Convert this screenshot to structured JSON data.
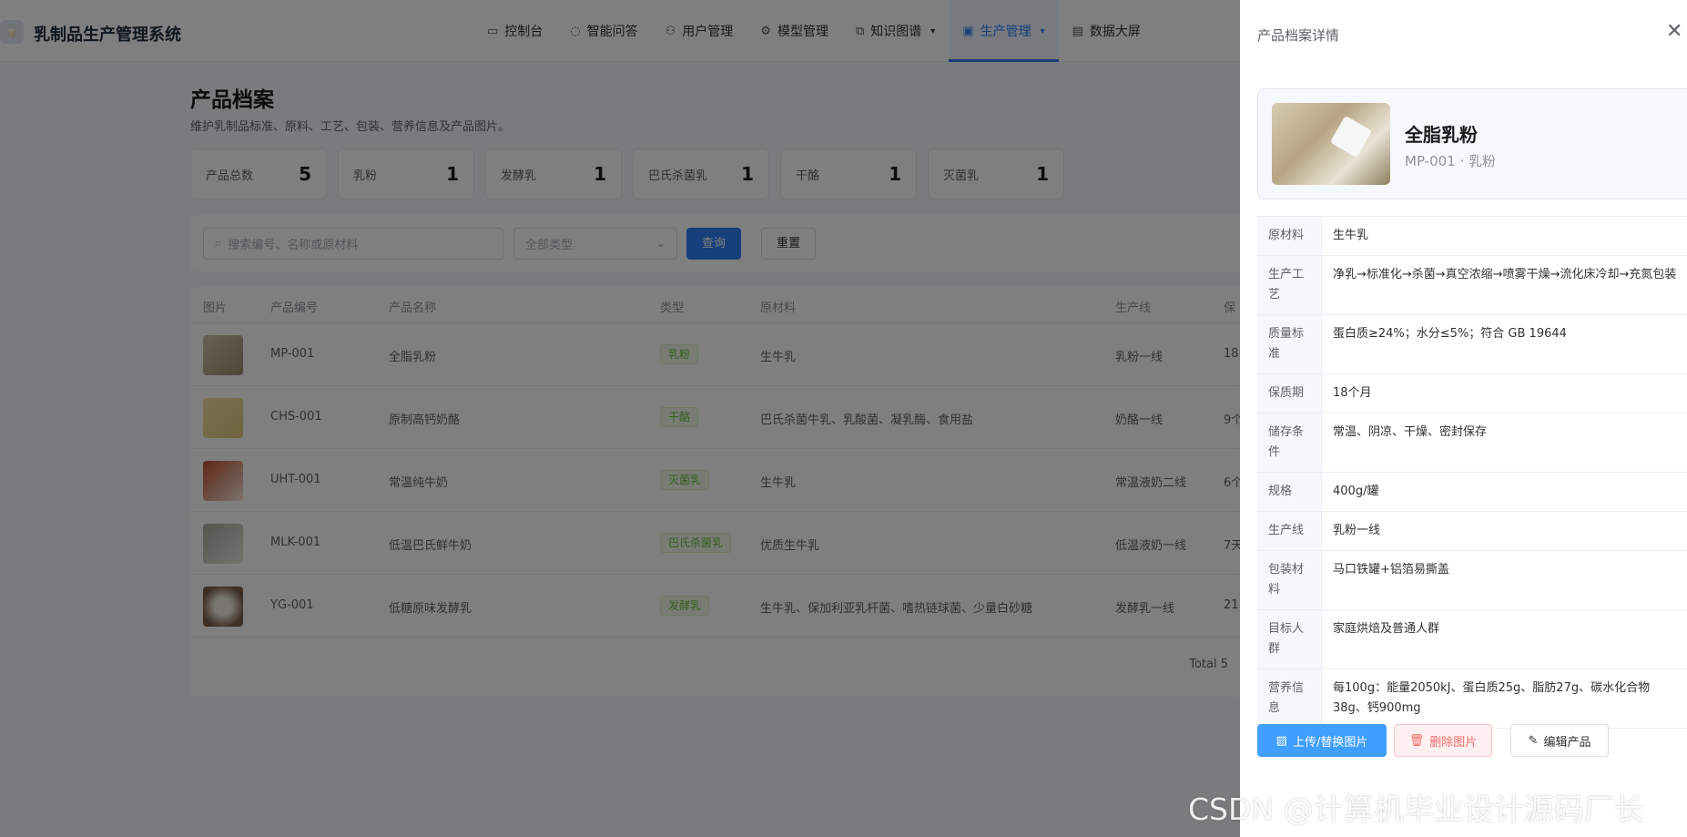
{
  "header": {
    "app_title": "乳制品生产管理系统",
    "logo_icon": "milk-cup-icon",
    "nav": [
      {
        "label": "控制台",
        "icon": "monitor-icon"
      },
      {
        "label": "智能问答",
        "icon": "chat-icon"
      },
      {
        "label": "用户管理",
        "icon": "user-icon"
      },
      {
        "label": "模型管理",
        "icon": "gear-icon"
      },
      {
        "label": "知识图谱",
        "icon": "graph-icon"
      },
      {
        "label": "生产管理",
        "icon": "factory-icon"
      },
      {
        "label": "数据大屏",
        "icon": "dashboard-icon"
      }
    ]
  },
  "page": {
    "title": "产品档案",
    "subtitle": "维护乳制品标准、原料、工艺、包装、营养信息及产品图片。"
  },
  "stats": [
    {
      "label": "产品总数",
      "value": "5"
    },
    {
      "label": "乳粉",
      "value": "1"
    },
    {
      "label": "发酵乳",
      "value": "1"
    },
    {
      "label": "巴氏杀菌乳",
      "value": "1"
    },
    {
      "label": "干酪",
      "value": "1"
    },
    {
      "label": "灭菌乳",
      "value": "1"
    }
  ],
  "filter": {
    "search_placeholder": "搜索编号、名称或原材料",
    "type_placeholder": "全部类型",
    "query_label": "查询",
    "reset_label": "重置"
  },
  "table": {
    "headers": [
      "图片",
      "产品编号",
      "产品名称",
      "类型",
      "原材料",
      "生产线",
      "保"
    ],
    "rows": [
      {
        "code": "MP-001",
        "name": "全脂乳粉",
        "type": "乳粉",
        "material": "生牛乳",
        "line": "乳粉一线",
        "shelf": "18"
      },
      {
        "code": "CHS-001",
        "name": "原制高钙奶酪",
        "type": "干酪",
        "material": "巴氏杀菌牛乳、乳酸菌、凝乳酶、食用盐",
        "line": "奶酪一线",
        "shelf": "9个"
      },
      {
        "code": "UHT-001",
        "name": "常温纯牛奶",
        "type": "灭菌乳",
        "material": "生牛乳",
        "line": "常温液奶二线",
        "shelf": "6个"
      },
      {
        "code": "MLK-001",
        "name": "低温巴氏鲜牛奶",
        "type": "巴氏杀菌乳",
        "material": "优质生牛乳",
        "line": "低温液奶一线",
        "shelf": "7天"
      },
      {
        "code": "YG-001",
        "name": "低糖原味发酵乳",
        "type": "发酵乳",
        "material": "生牛乳、保加利亚乳杆菌、嗜热链球菌、少量白砂糖",
        "line": "发酵乳一线",
        "shelf": "21"
      }
    ],
    "total": "Total 5"
  },
  "drawer": {
    "title": "产品档案详情",
    "product_name": "全脂乳粉",
    "product_meta": "MP-001 · 乳粉",
    "details": [
      {
        "label": "原材料",
        "value": "生牛乳"
      },
      {
        "label": "生产工艺",
        "value": "净乳→标准化→杀菌→真空浓缩→喷雾干燥→流化床冷却→充氮包装"
      },
      {
        "label": "质量标准",
        "value": "蛋白质≥24%；水分≤5%；符合 GB 19644"
      },
      {
        "label": "保质期",
        "value": "18个月"
      },
      {
        "label": "储存条件",
        "value": "常温、阴凉、干燥、密封保存"
      },
      {
        "label": "规格",
        "value": "400g/罐"
      },
      {
        "label": "生产线",
        "value": "乳粉一线"
      },
      {
        "label": "包装材料",
        "value": "马口铁罐+铝箔易撕盖"
      },
      {
        "label": "目标人群",
        "value": "家庭烘焙及普通人群"
      },
      {
        "label": "营养信息",
        "value": "每100g：能量2050kJ、蛋白质25g、脂肪27g、碳水化合物38g、钙900mg"
      }
    ],
    "upload_label": "上传/替换图片",
    "delete_label": "删除图片",
    "edit_label": "编辑产品"
  },
  "watermark": "CSDN @计算机毕业设计源码厂长"
}
